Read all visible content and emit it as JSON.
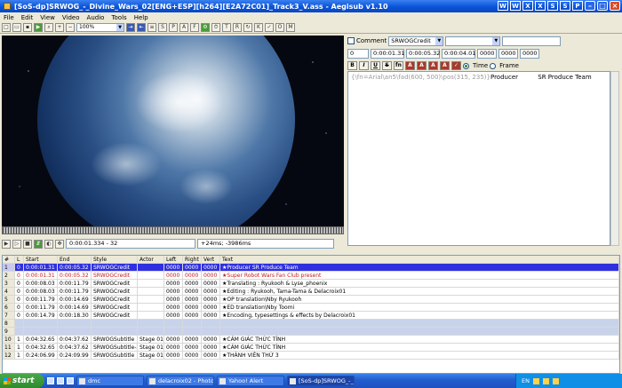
{
  "window": {
    "title": "[SoS-dp]SRWOG_-_Divine_Wars_02[ENG+ESP][h264][E2A72C01]_Track3_V.ass - Aegisub v1.10",
    "tray_icons": [
      "W",
      "W",
      "X",
      "X",
      "S",
      "S",
      "P"
    ]
  },
  "menu": [
    "File",
    "Edit",
    "View",
    "Video",
    "Audio",
    "Tools",
    "Help"
  ],
  "toolbar": {
    "zoom": "100%"
  },
  "video_controls": {
    "position": "0:00:01.334 - 32",
    "offset": "+24ms; -3986ms"
  },
  "editor": {
    "comment_label": "Comment",
    "style": "SRWOGCredit",
    "layer": "0",
    "start": "0:00:01.31",
    "end": "0:00:05.32",
    "duration": "0:00:04.01",
    "margin_l": "0000",
    "margin_r": "0000",
    "margin_v": "0000",
    "time_label": "Time",
    "frame_label": "Frame",
    "text_tags": "{\\fn=Arial\\an5\\fad(600, 500)\\pos(315, 235)}",
    "text_body": "Producer          SR Produce Team"
  },
  "grid": {
    "headers": [
      "#",
      "L",
      "Start",
      "End",
      "Style",
      "Actor",
      "Left",
      "Right",
      "Vert",
      "Text"
    ],
    "rows": [
      {
        "n": "1",
        "l": "0",
        "start": "0:00:01.31",
        "end": "0:00:05.32",
        "style": "SRWOGCredit",
        "actor": "",
        "left": "0000",
        "right": "0000",
        "vert": "0000",
        "text": "★Producer          SR Produce Team",
        "kind": "sel"
      },
      {
        "n": "2",
        "l": "0",
        "start": "0:00:01.31",
        "end": "0:00:05.32",
        "style": "SRWOGCredit",
        "actor": "",
        "left": "0000",
        "right": "0000",
        "vert": "0000",
        "text": "★Super Robot Wars Fan Club present",
        "kind": "red"
      },
      {
        "n": "3",
        "l": "0",
        "start": "0:00:08.03",
        "end": "0:00:11.79",
        "style": "SRWOGCredit",
        "actor": "",
        "left": "0000",
        "right": "0000",
        "vert": "0000",
        "text": "★Translating :         Ryukooh & Lyse_phoenix",
        "kind": ""
      },
      {
        "n": "4",
        "l": "0",
        "start": "0:00:08.03",
        "end": "0:00:11.79",
        "style": "SRWOGCredit",
        "actor": "",
        "left": "0000",
        "right": "0000",
        "vert": "0000",
        "text": "★Editing :        Ryukooh, Tama-Tama & Delacroix01",
        "kind": ""
      },
      {
        "n": "5",
        "l": "0",
        "start": "0:00:11.79",
        "end": "0:00:14.69",
        "style": "SRWOGCredit",
        "actor": "",
        "left": "0000",
        "right": "0000",
        "vert": "0000",
        "text": "★OP translation\\Nby Ryukooh",
        "kind": ""
      },
      {
        "n": "6",
        "l": "0",
        "start": "0:00:11.79",
        "end": "0:00:14.69",
        "style": "SRWOGCredit",
        "actor": "",
        "left": "0000",
        "right": "0000",
        "vert": "0000",
        "text": "★ED translation\\Nby Toomi",
        "kind": ""
      },
      {
        "n": "7",
        "l": "0",
        "start": "0:00:14.79",
        "end": "0:00:18.30",
        "style": "SRWOGCredit",
        "actor": "",
        "left": "0000",
        "right": "0000",
        "vert": "0000",
        "text": "★Encoding, typesettings & effects by Delacroix01",
        "kind": ""
      },
      {
        "n": "8",
        "l": "",
        "start": "",
        "end": "",
        "style": "",
        "actor": "",
        "left": "",
        "right": "",
        "vert": "",
        "text": "",
        "kind": "pale"
      },
      {
        "n": "9",
        "l": "",
        "start": "",
        "end": "",
        "style": "",
        "actor": "",
        "left": "",
        "right": "",
        "vert": "",
        "text": "",
        "kind": "pale"
      },
      {
        "n": "10",
        "l": "1",
        "start": "0:04:32.65",
        "end": "0:04:37.62",
        "style": "SRWOGSubtitle",
        "actor": "Stage 01",
        "left": "0000",
        "right": "0000",
        "vert": "0000",
        "text": "★CẢM GIÁC THỨC TỈNH",
        "kind": ""
      },
      {
        "n": "11",
        "l": "1",
        "start": "0:04:32.65",
        "end": "0:04:37.62",
        "style": "SRWOGSubtitle-2",
        "actor": "Stage 01",
        "left": "0000",
        "right": "0000",
        "vert": "0000",
        "text": "★CẢM GIÁC THỨC TỈNH",
        "kind": ""
      },
      {
        "n": "12",
        "l": "1",
        "start": "0:24:06.99",
        "end": "0:24:09.99",
        "style": "SRWOGSubtitle",
        "actor": "Stage 01",
        "left": "0000",
        "right": "0000",
        "vert": "0000",
        "text": "★THÀNH VIÊN THỨ 3",
        "kind": ""
      }
    ]
  },
  "taskbar": {
    "start": "start",
    "tasks": [
      "dmc",
      "delacroix02 - Photob...",
      "Yahoo! Alert",
      "[SoS-dp]SRWOG_-_D..."
    ],
    "lang": "EN"
  }
}
